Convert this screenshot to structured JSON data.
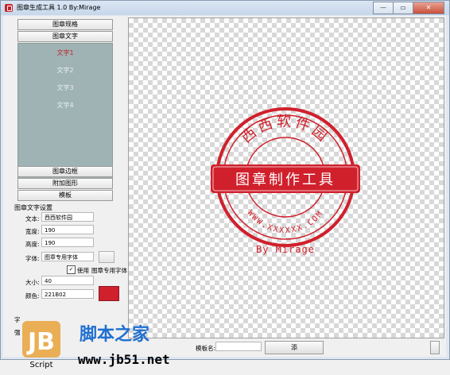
{
  "window": {
    "title": "图章生成工具 1.0   By:Mirage",
    "controls": {
      "minimize": "—",
      "maximize": "▭",
      "close": "✕"
    }
  },
  "sidebar": {
    "sections": [
      "图章规格",
      "图章文字",
      "图章边框",
      "附加图形",
      "模板"
    ],
    "text_items": [
      "文字1",
      "文字2",
      "文字3",
      "文字4"
    ]
  },
  "settings": {
    "title": "图章文字设置",
    "text_label": "文本:",
    "text_value": "西西软件园",
    "width_label": "宽度:",
    "width_value": "190",
    "height_label": "高度:",
    "height_value": "190",
    "font_label": "字体:",
    "font_value": "图章专用字体",
    "use_label": "使用",
    "use_font_label": "图章专用字体",
    "size_label": "大小:",
    "size_value": "40",
    "color_label": "颜色:",
    "color_value": "221B02",
    "cut_label_a": "字",
    "cut_label_b": "强"
  },
  "stamp": {
    "top_text": "西西软件园",
    "banner_text": "图章制作工具",
    "bottom_text": "WWW.XXXXXX.COM",
    "signature": "By Mirage",
    "color": "#d0202c"
  },
  "bottom_bar": {
    "template_label": "模板名:",
    "template_value": "",
    "generate_label": "添"
  },
  "watermark": {
    "logo_letters": "JB",
    "script_label": "Script",
    "site_cn": "脚本之家",
    "site_url": "www.jb51.net"
  }
}
